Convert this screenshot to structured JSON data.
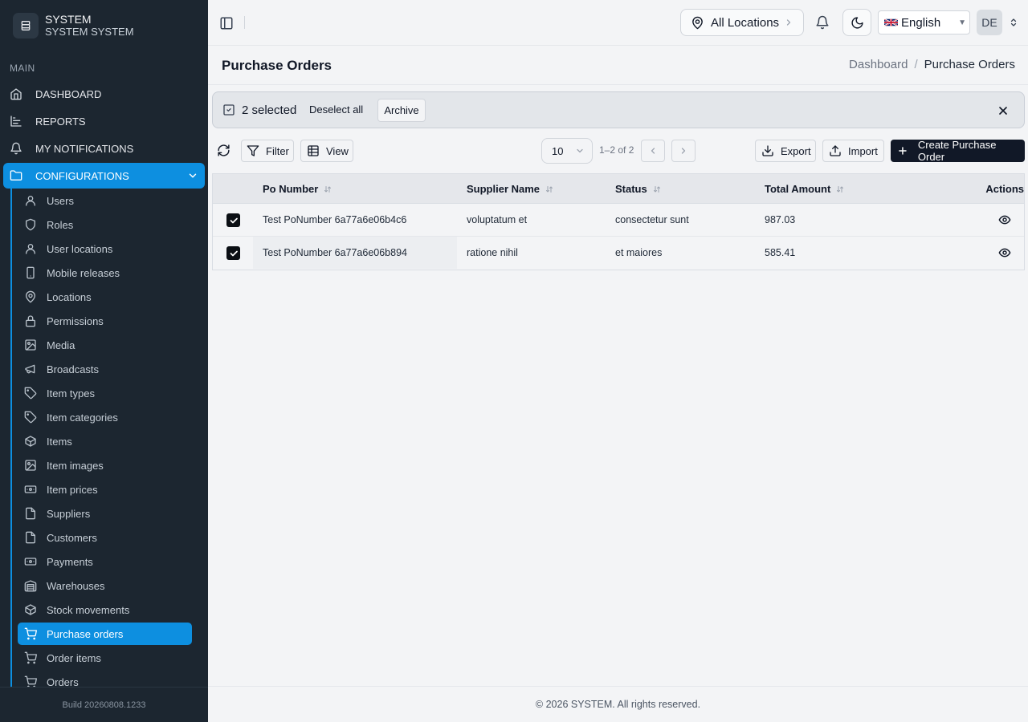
{
  "brand": {
    "title": "SYSTEM",
    "subtitle": "SYSTEM SYSTEM"
  },
  "sidebar": {
    "section_label": "MAIN",
    "items": [
      {
        "label": "DASHBOARD",
        "icon": "home-icon"
      },
      {
        "label": "REPORTS",
        "icon": "chart-icon"
      },
      {
        "label": "MY NOTIFICATIONS",
        "icon": "bell-icon"
      },
      {
        "label": "CONFIGURATIONS",
        "icon": "folder-icon",
        "active": true
      }
    ],
    "sub_items": [
      {
        "label": "Users",
        "icon": "user-icon"
      },
      {
        "label": "Roles",
        "icon": "shield-icon"
      },
      {
        "label": "User locations",
        "icon": "user-icon"
      },
      {
        "label": "Mobile releases",
        "icon": "smartphone-icon"
      },
      {
        "label": "Locations",
        "icon": "map-pin-icon"
      },
      {
        "label": "Permissions",
        "icon": "lock-icon"
      },
      {
        "label": "Media",
        "icon": "image-icon"
      },
      {
        "label": "Broadcasts",
        "icon": "megaphone-icon"
      },
      {
        "label": "Item types",
        "icon": "tag-icon"
      },
      {
        "label": "Item categories",
        "icon": "tag-icon"
      },
      {
        "label": "Items",
        "icon": "box-icon"
      },
      {
        "label": "Item images",
        "icon": "image-icon"
      },
      {
        "label": "Item prices",
        "icon": "banknote-icon"
      },
      {
        "label": "Suppliers",
        "icon": "file-icon"
      },
      {
        "label": "Customers",
        "icon": "file-icon"
      },
      {
        "label": "Payments",
        "icon": "banknote-icon"
      },
      {
        "label": "Warehouses",
        "icon": "warehouse-icon"
      },
      {
        "label": "Stock movements",
        "icon": "box-icon"
      },
      {
        "label": "Purchase orders",
        "icon": "cart-icon",
        "active": true
      },
      {
        "label": "Order items",
        "icon": "cart-icon"
      },
      {
        "label": "Orders",
        "icon": "cart-icon"
      }
    ],
    "build": "Build 20260808.1233"
  },
  "topbar": {
    "location_label": "All Locations",
    "language_label": "English",
    "language_flag": "gb-flag",
    "avatar_initials": "DE"
  },
  "page": {
    "title": "Purchase Orders",
    "breadcrumb": {
      "home": "Dashboard",
      "current": "Purchase Orders"
    }
  },
  "selection": {
    "count_label": "2 selected",
    "deselect_label": "Deselect all",
    "archive_label": "Archive"
  },
  "toolbar": {
    "filter_label": "Filter",
    "view_label": "View",
    "page_size": "10",
    "range_label": "1–2 of 2",
    "export_label": "Export",
    "import_label": "Import",
    "create_label": "Create Purchase Order"
  },
  "table": {
    "columns": [
      "Po Number",
      "Supplier Name",
      "Status",
      "Total Amount",
      "Actions"
    ],
    "rows": [
      {
        "po_number": "Test PoNumber 6a77a6e06b4c6",
        "supplier": "voluptatum et",
        "status": "consectetur sunt",
        "total": "987.03",
        "selected": true
      },
      {
        "po_number": "Test PoNumber 6a77a6e06b894",
        "supplier": "ratione nihil",
        "status": "et maiores",
        "total": "585.41",
        "selected": true
      }
    ]
  },
  "footer": {
    "text": "© 2026 SYSTEM. All rights reserved."
  },
  "colors": {
    "accent": "#0d8fe0",
    "sidebar_bg": "#1c2630",
    "primary_button": "#111827"
  }
}
